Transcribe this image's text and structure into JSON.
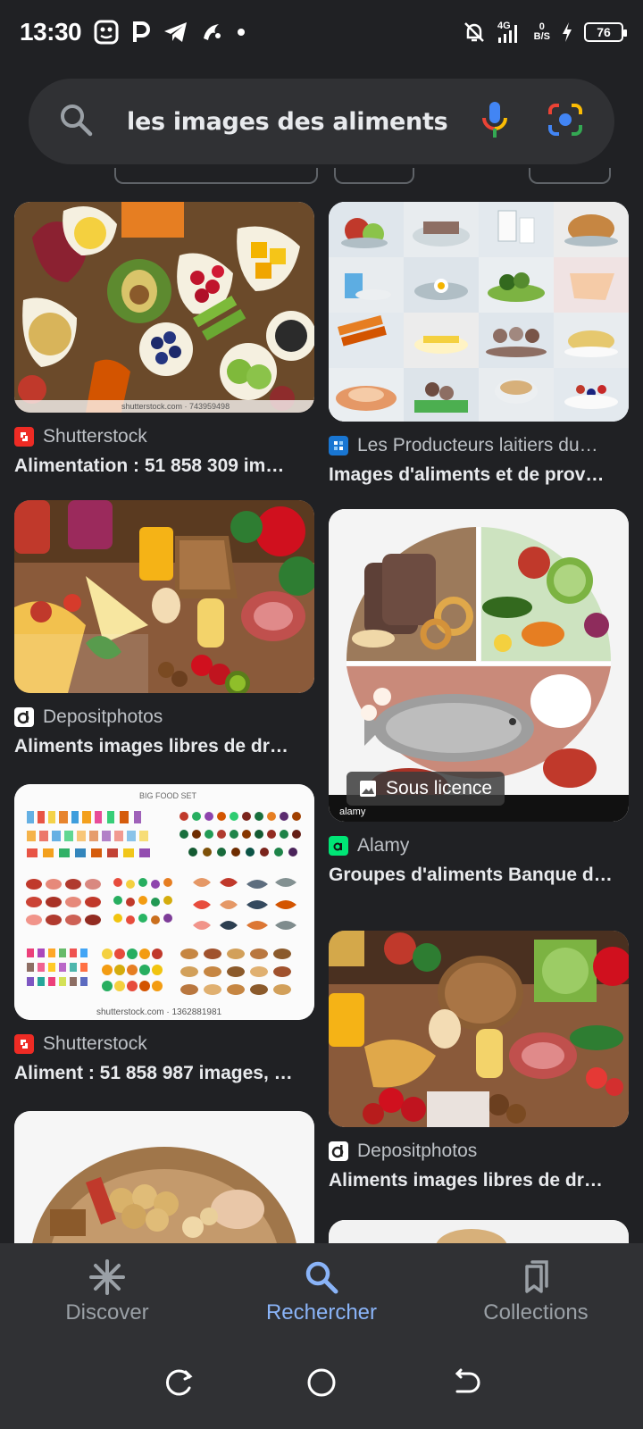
{
  "status_bar": {
    "time": "13:30",
    "network": "4G",
    "net_speed_value": "0",
    "net_speed_unit": "B/S",
    "battery": "76"
  },
  "search": {
    "query": "les images des aliments"
  },
  "results": {
    "left": [
      {
        "source": "Shutterstock",
        "title": "Alimentation : 51 858 309 im…",
        "favicon": "shutterstock-icon",
        "caption": "shutterstock.com · 743959498"
      },
      {
        "source": "Depositphotos",
        "title": "Aliments images libres de dr…",
        "favicon": "depositphotos-icon"
      },
      {
        "source": "Shutterstock",
        "title": "Aliment : 51 858 987 images, …",
        "favicon": "shutterstock-icon",
        "caption": "shutterstock.com · 1362881981",
        "image_label": "BIG FOOD SET"
      }
    ],
    "right": [
      {
        "source": "Les Producteurs laitiers du…",
        "title": "Images d'aliments et de prov…",
        "favicon": "producteurs-laitiers-icon"
      },
      {
        "source": "Alamy",
        "title": "Groupes d'aliments Banque d…",
        "favicon": "alamy-icon",
        "badge": "Sous licence",
        "watermark": "alamy"
      },
      {
        "source": "Depositphotos",
        "title": "Aliments images libres de dr…",
        "favicon": "depositphotos-icon"
      }
    ]
  },
  "bottom_nav": {
    "discover": "Discover",
    "search": "Rechercher",
    "collections": "Collections"
  },
  "colors": {
    "background": "#202124",
    "accent": "#8ab4f8",
    "shutterstock": "#ee2b24",
    "alamy": "#00e676"
  }
}
